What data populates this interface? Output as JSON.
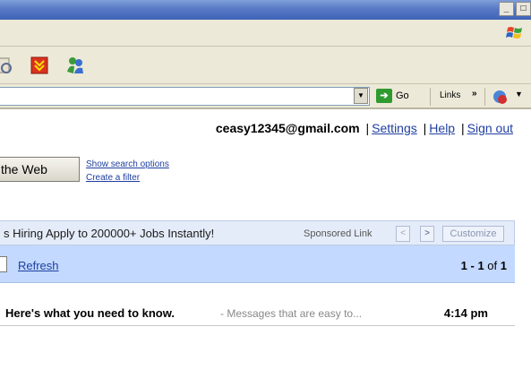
{
  "window": {
    "minimize": "_",
    "maximize": "□"
  },
  "address_bar": {
    "go_label": "Go",
    "links_label": "Links",
    "links_chevron": "»"
  },
  "account": {
    "email": "ceasy12345@gmail.com",
    "separator": "|",
    "settings": "Settings",
    "help": "Help",
    "sign_out": "Sign out"
  },
  "search": {
    "button_label": "the Web",
    "show_options": "Show search options",
    "create_filter": "Create a filter"
  },
  "ad": {
    "text": "s Hiring Apply to 200000+ Jobs Instantly!",
    "sponsored": "Sponsored Link",
    "prev": "<",
    "next": ">",
    "customize": "Customize"
  },
  "actions": {
    "refresh": "Refresh",
    "range": "1 - 1",
    "of_label": "of",
    "total": "1"
  },
  "messages": [
    {
      "subject": "Here's what you need to know.",
      "snippet": "- Messages that are easy to...",
      "time": "4:14 pm"
    }
  ],
  "icons": [
    "toolbar-icon-1",
    "download-icon",
    "messenger-icon",
    "windows-logo-icon",
    "go-arrow-icon",
    "ie-page-icon"
  ],
  "colors": {
    "titlebar": "#5879c6",
    "link": "#1f3fa0",
    "ad_bar": "#e5ecf9",
    "action_bar": "#c3d9ff"
  }
}
